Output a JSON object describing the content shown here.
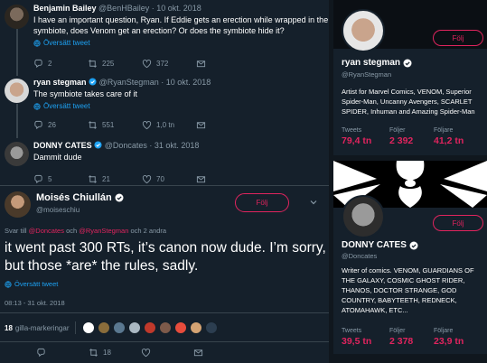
{
  "colors": {
    "background": "#15202b",
    "accent": "#e0245e",
    "link": "#1da1f2",
    "muted": "#8899a6",
    "border": "#38444d"
  },
  "replies": [
    {
      "name": "Benjamin Bailey",
      "handle_time": "@BenHBailey · 10 okt. 2018",
      "text": "I have an important question, Ryan. If Eddie gets an erection while wrapped in the symbiote, does Venom get an erection? Or does the symbiote hide it?",
      "translate": "Översätt tweet",
      "counts": {
        "reply": "2",
        "retweet": "225",
        "like": "372"
      }
    },
    {
      "name": "ryan stegman",
      "verified": true,
      "handle_time": "@RyanStegman · 10 okt. 2018",
      "text": "The symbiote takes care of it",
      "translate": "Översätt tweet",
      "counts": {
        "reply": "26",
        "retweet": "551",
        "like": "1,0 tn"
      }
    },
    {
      "name": "DONNY CATES",
      "verified": true,
      "handle_time": "@Doncates · 31 okt. 2018",
      "text": "Dammit dude",
      "translate": "",
      "counts": {
        "reply": "5",
        "retweet": "21",
        "like": "70"
      }
    }
  ],
  "main": {
    "name": "Moisés Chiullán",
    "handle": "@moiseschiu",
    "follow_label": "Följ",
    "reply_prefix": "Svar till ",
    "reply_user1": "@Doncates",
    "reply_and": " och ",
    "reply_user2": "@RyanStegman",
    "reply_suffix": " och 2 andra",
    "text": "it went past 300 RTs, it’s canon now dude. I’m sorry, but those *are* the rules, sadly.",
    "translate": "Översätt tweet",
    "timestamp": "08:13 - 31 okt. 2018",
    "likes_count": "18",
    "likes_label": "gilla-markeringar",
    "counts": {
      "retweet": "18"
    }
  },
  "cards": [
    {
      "name": "ryan stegman",
      "handle": "@RyanStegman",
      "follow_label": "Följ",
      "bio": "Artist for Marvel Comics, VENOM, Superior Spider-Man, Uncanny Avengers, SCARLET SPIDER, Inhuman and Amazing Spider-Man",
      "stats": [
        {
          "label": "Tweets",
          "value": "79,4 tn"
        },
        {
          "label": "Följer",
          "value": "2 392"
        },
        {
          "label": "Följare",
          "value": "41,2 tn"
        }
      ]
    },
    {
      "name": "DONNY CATES",
      "handle": "@Doncates",
      "follow_label": "Följ",
      "bio": "Writer of comics. VENOM, GUARDIANS OF THE GALAXY, COSMIC GHOST RIDER, THANOS, DOCTOR STRANGE, GOD COUNTRY, BABYTEETH, REDNECK, ATOMAHAWK, ETC...",
      "stats": [
        {
          "label": "Tweets",
          "value": "39,5 tn"
        },
        {
          "label": "Följer",
          "value": "2 378"
        },
        {
          "label": "Följare",
          "value": "23,9 tn"
        }
      ]
    }
  ]
}
